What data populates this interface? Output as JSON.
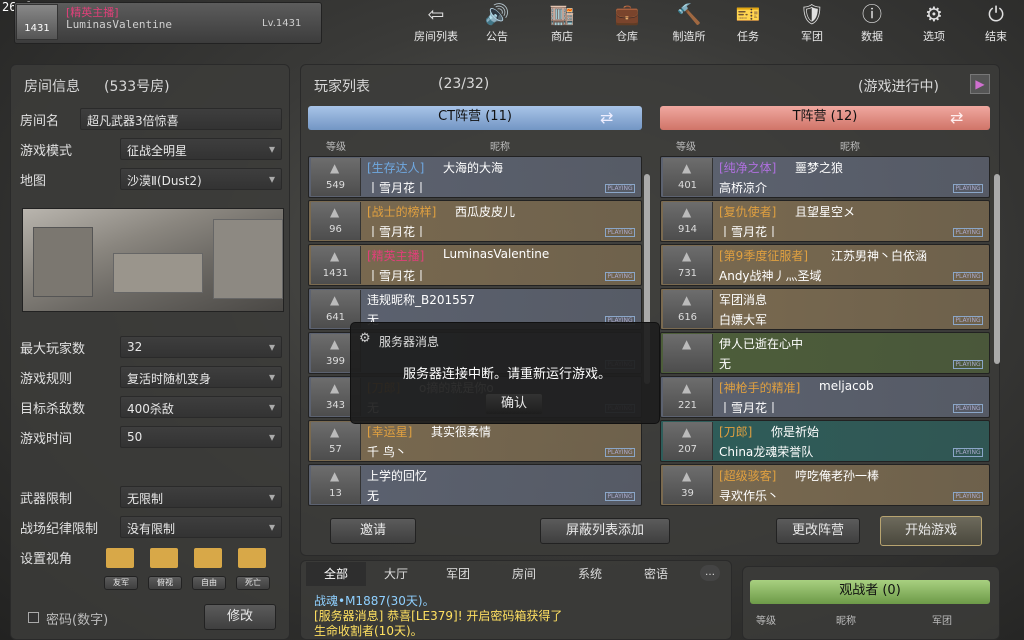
{
  "fps": "26 fps",
  "user": {
    "level": "1431",
    "tag": "[精英主播]",
    "name": "LuminasValentine",
    "lv": "Lv.1431"
  },
  "nav": [
    {
      "label": "房间列表",
      "icon": "back-arrow-icon",
      "glyph": "⇦"
    },
    {
      "label": "公告",
      "icon": "speaker-icon",
      "glyph": "🔊"
    },
    {
      "label": "商店",
      "icon": "shop-icon",
      "glyph": "🏬"
    },
    {
      "label": "仓库",
      "icon": "briefcase-icon",
      "glyph": "💼"
    },
    {
      "label": "制造所",
      "icon": "hammer-icon",
      "glyph": "🔨"
    },
    {
      "label": "任务",
      "icon": "ticket-icon",
      "glyph": "🎫"
    },
    {
      "label": "军团",
      "icon": "shield-icon",
      "glyph": "🛡"
    },
    {
      "label": "数据",
      "icon": "info-icon",
      "glyph": "ⓘ"
    },
    {
      "label": "选项",
      "icon": "gear-icon",
      "glyph": "⚙"
    },
    {
      "label": "结束",
      "icon": "power-icon",
      "glyph": "⏻"
    }
  ],
  "room": {
    "title": "房间信息",
    "number": "(533号房)",
    "name_label": "房间名",
    "name": "超凡武器3倍惊喜",
    "mode_label": "游戏模式",
    "mode": "征战全明星",
    "map_label": "地图",
    "map": "沙漠Ⅱ(Dust2)",
    "max_label": "最大玩家数",
    "max": "32",
    "rule_label": "游戏规则",
    "rule": "复活时随机变身",
    "kills_label": "目标杀敌数",
    "kills": "400杀敌",
    "time_label": "游戏时间",
    "time": "50",
    "weapon_label": "武器限制",
    "weapon": "无限制",
    "disc_label": "战场纪律限制",
    "disc": "没有限制",
    "view_label": "设置视角",
    "view_buttons": [
      "友军",
      "俯视",
      "自由",
      "死亡"
    ],
    "password_label": "密码(数字)",
    "modify": "修改"
  },
  "players": {
    "title": "玩家列表",
    "count": "(23/32)",
    "status": "(游戏进行中)",
    "ct_header": "CT阵营 (11)",
    "t_header": "T阵营 (12)",
    "col_level": "等级",
    "col_name": "昵称",
    "playing": "PLAYING",
    "ct": [
      {
        "lvl": "549",
        "tag": "[生存达人]",
        "name": "大海的大海",
        "sub": "丨雪月花丨",
        "tagc": "#6fa8e0",
        "bg": "#5c6270"
      },
      {
        "lvl": "96",
        "tag": "[战士的榜样]",
        "name": "西瓜皮皮儿",
        "sub": "丨雪月花丨",
        "tagc": "#e0a040",
        "bg": "#7a6a50"
      },
      {
        "lvl": "1431",
        "tag": "[精英主播]",
        "name": "LuminasValentine",
        "sub": "丨雪月花丨",
        "tagc": "#e0407a",
        "bg": "#7a6a50"
      },
      {
        "lvl": "641",
        "tag": "",
        "name": "违规昵称_B201557",
        "sub": "无",
        "tagc": "#fff",
        "bg": "#5c6270"
      },
      {
        "lvl": "399",
        "tag": "",
        "name": "",
        "sub": "",
        "tagc": "#fff",
        "bg": "#5c6270"
      },
      {
        "lvl": "343",
        "tag": "[刀郎]",
        "name": "o摘的就是你o",
        "sub": "无",
        "tagc": "#e0a040",
        "bg": "#5c6270"
      },
      {
        "lvl": "57",
        "tag": "[幸运星]",
        "name": "其实很柔情",
        "sub": "千 鸟丶",
        "tagc": "#e0a040",
        "bg": "#7a6a50"
      },
      {
        "lvl": "13",
        "tag": "",
        "name": "上学的回忆",
        "sub": "无",
        "tagc": "#fff",
        "bg": "#5c6270"
      }
    ],
    "t": [
      {
        "lvl": "401",
        "tag": "[纯净之体]",
        "name": "噩梦之狼",
        "sub": "高桥凉介",
        "tagc": "#b070e0",
        "bg": "#5c6270"
      },
      {
        "lvl": "914",
        "tag": "[复仇使者]",
        "name": "且望星空メ",
        "sub": "丨雪月花丨",
        "tagc": "#e0a040",
        "bg": "#7a6a50"
      },
      {
        "lvl": "731",
        "tag": "[第9季度征服者]",
        "name": "江苏男神丶白依涵",
        "sub": "Andy战神丿灬圣域",
        "tagc": "#e0a040",
        "bg": "#7a6a50"
      },
      {
        "lvl": "616",
        "tag": "",
        "name": "军团消息",
        "sub": "白嫖大军",
        "tagc": "#fff",
        "bg": "#7a6a50"
      },
      {
        "lvl": "",
        "tag": "",
        "name": "伊人已逝在心中",
        "sub": "无",
        "tagc": "#fff",
        "bg": "#4d5e3a"
      },
      {
        "lvl": "221",
        "tag": "[神枪手的精准]",
        "name": "meljacob",
        "sub": "丨雪月花丨",
        "tagc": "#e0a040",
        "bg": "#5c6270"
      },
      {
        "lvl": "207",
        "tag": "[刀郎]",
        "name": "你是祈始",
        "sub": "China龙魂荣誉队",
        "tagc": "#e0a040",
        "bg": "#2e5d5a"
      },
      {
        "lvl": "39",
        "tag": "[超级骇客]",
        "name": "哼吃俺老孙一棒",
        "sub": "寻欢作乐丶",
        "tagc": "#e0a040",
        "bg": "#7a6a50"
      }
    ],
    "invite": "邀请",
    "block": "屏蔽列表添加",
    "change_team": "更改阵营",
    "start": "开始游戏"
  },
  "modal": {
    "title": "服务器消息",
    "message": "服务器连接中断。请重新运行游戏。",
    "ok": "确认"
  },
  "chat": {
    "tabs": [
      "全部",
      "大厅",
      "军团",
      "房间",
      "系统",
      "密语"
    ],
    "lines": [
      {
        "text": "战魂•M1887(30天)。",
        "color": "#8fd0ff"
      },
      {
        "text": "[服务器消息] 恭喜[LE379]! 开启密码箱获得了",
        "color": "#ffe060"
      },
      {
        "text": "生命收割者(10天)。",
        "color": "#ffe060"
      }
    ]
  },
  "spectators": {
    "title": "观战者 (0)",
    "col_level": "等级",
    "col_name": "昵称",
    "col_clan": "军团"
  }
}
